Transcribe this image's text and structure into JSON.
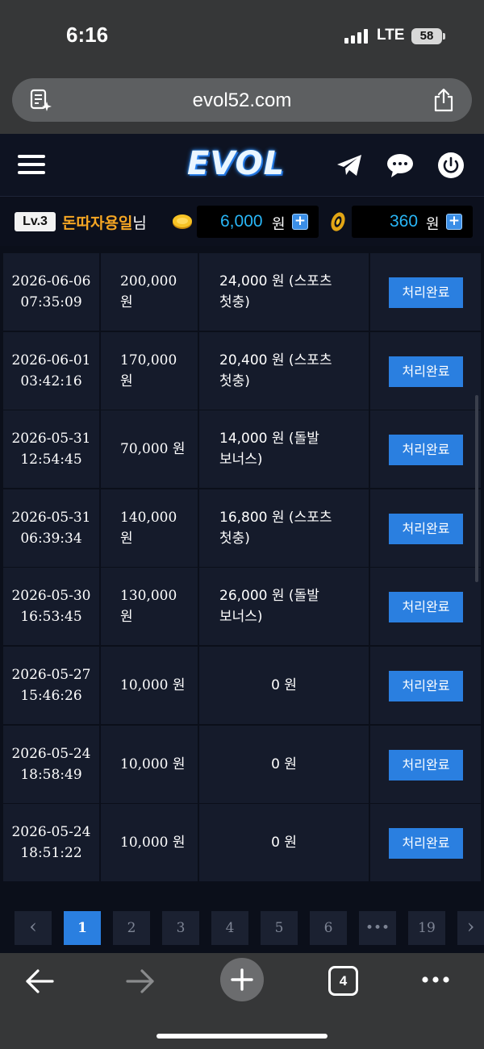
{
  "status_bar": {
    "time": "6:16",
    "network": "LTE",
    "battery": "58"
  },
  "browser": {
    "url": "evol52.com",
    "tab_count": "4"
  },
  "header": {
    "logo": "EVOL"
  },
  "user": {
    "level": "Lv.3",
    "name": "돈따자용일",
    "suffix": "님",
    "money": "6,000",
    "money_unit": "원",
    "points": "360",
    "points_unit": "원"
  },
  "rows": [
    {
      "date": "2026-06-06",
      "time": "07:35:09",
      "amount_line1": "200,000",
      "amount_line2": "원",
      "bonus_line1": "24,000 원 (스포츠",
      "bonus_line2": "첫충)",
      "status": "처리완료"
    },
    {
      "date": "2026-06-01",
      "time": "03:42:16",
      "amount_line1": "170,000",
      "amount_line2": "원",
      "bonus_line1": "20,400 원 (스포츠",
      "bonus_line2": "첫충)",
      "status": "처리완료"
    },
    {
      "date": "2026-05-31",
      "time": "12:54:45",
      "amount_line1": "70,000 원",
      "amount_line2": "",
      "bonus_line1": "14,000 원 (돌발",
      "bonus_line2": "보너스)",
      "status": "처리완료"
    },
    {
      "date": "2026-05-31",
      "time": "06:39:34",
      "amount_line1": "140,000",
      "amount_line2": "원",
      "bonus_line1": "16,800 원 (스포츠",
      "bonus_line2": "첫충)",
      "status": "처리완료"
    },
    {
      "date": "2026-05-30",
      "time": "16:53:45",
      "amount_line1": "130,000",
      "amount_line2": "원",
      "bonus_line1": "26,000 원 (돌발",
      "bonus_line2": "보너스)",
      "status": "처리완료"
    },
    {
      "date": "2026-05-27",
      "time": "15:46:26",
      "amount_line1": "10,000 원",
      "amount_line2": "",
      "bonus_line1": "0 원",
      "bonus_line2": "",
      "status": "처리완료"
    },
    {
      "date": "2026-05-24",
      "time": "18:58:49",
      "amount_line1": "10,000 원",
      "amount_line2": "",
      "bonus_line1": "0 원",
      "bonus_line2": "",
      "status": "처리완료"
    },
    {
      "date": "2026-05-24",
      "time": "18:51:22",
      "amount_line1": "10,000 원",
      "amount_line2": "",
      "bonus_line1": "0 원",
      "bonus_line2": "",
      "status": "처리완료"
    }
  ],
  "pagination": {
    "prev": "‹",
    "pages": [
      "1",
      "2",
      "3",
      "4",
      "5",
      "6",
      "•••",
      "19"
    ],
    "next": "›",
    "current": "1"
  }
}
